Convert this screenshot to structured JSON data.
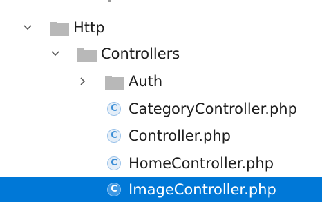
{
  "colors": {
    "selection_bg": "#0078d7",
    "selection_text": "#ffffff",
    "text": "#1e1e1e",
    "folder": "#b8b8b8",
    "arrow": "#5a5a5a",
    "php_class_icon": "#3c8ed6"
  },
  "tree": {
    "items": [
      {
        "label": "Http",
        "type": "folder",
        "expanded": true,
        "icon": "folder-icon"
      },
      {
        "label": "Controllers",
        "type": "folder",
        "expanded": true,
        "icon": "folder-icon"
      },
      {
        "label": "Auth",
        "type": "folder",
        "expanded": false,
        "icon": "folder-icon"
      },
      {
        "label": "CategoryController.php",
        "type": "file",
        "icon": "php-class-icon",
        "icon_glyph": "C"
      },
      {
        "label": "Controller.php",
        "type": "file",
        "icon": "php-class-icon",
        "icon_glyph": "C"
      },
      {
        "label": "HomeController.php",
        "type": "file",
        "icon": "php-class-icon",
        "icon_glyph": "C"
      },
      {
        "label": "ImageController.php",
        "type": "file",
        "icon": "php-class-icon",
        "icon_glyph": "C",
        "selected": true
      }
    ]
  }
}
